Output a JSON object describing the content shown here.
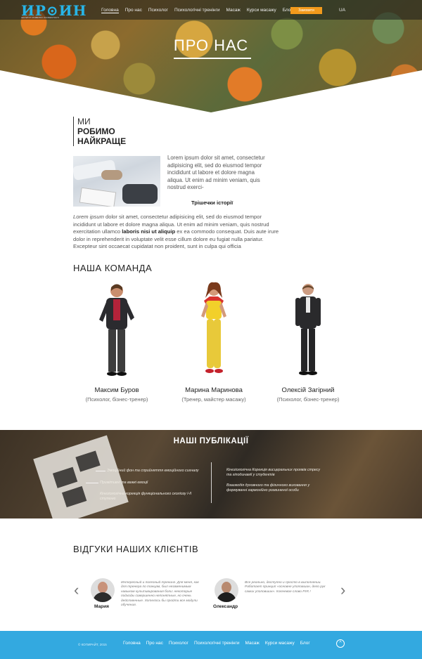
{
  "header": {
    "logo_text": "ИР⊙ИН",
    "logo_subtitle": "ІНСТИТУТ РОЗВИТКУ ОСОБИСТОСТІ",
    "nav": [
      "Головна",
      "Про нас",
      "Психолог",
      "Психологічні тренінги",
      "Масаж",
      "Курси масажу",
      "Блог"
    ],
    "order_button": "Замовити",
    "lang": "UA"
  },
  "hero": {
    "title": "ПРО НАС"
  },
  "about": {
    "we_line1": "МИ",
    "we_line2": "РОБИМО",
    "we_line3": "НАЙКРАЩЕ",
    "intro": "Lorem ipsum dolor sit amet, consectetur adipisicing elit, sed do eiusmod tempor incididunt ut labore et dolore magna aliqua. Ut enim ad minim veniam, quis nostrud exerci-",
    "more_link": "Трішечки історії",
    "body_em": "Lorem ipsum",
    "body_1": " dolor sit amet, consectetur adipisicing elit, sed do eiusmod tempor incididunt ut labore et dolore magna aliqua. Ut enim ad minim veniam, quis nostrud exercitation ullamco ",
    "body_bold": "laboris nisi ut aliquip",
    "body_2": " ex ea commodo consequat. Duis aute irure dolor in reprehenderit in voluptate velit esse cillum dolore eu fugiat nulla pariatur. Excepteur sint occaecat cupidatat non proident, sunt in culpa qui officia"
  },
  "team": {
    "title": "НАША КОМАНДА",
    "members": [
      {
        "name": "Максим Буров",
        "role": "(Психолог, бізнес-тренер)"
      },
      {
        "name": "Марина Маринова",
        "role": "(Тренер, майстер масажу)"
      },
      {
        "name": "Олексій Загірний",
        "role": "(Психолог, бізнес-тренер)"
      }
    ]
  },
  "publications": {
    "title": "НАШІ ПУБЛІКАЦІЇ",
    "left": [
      "Эмоційний фон та сприйняття емоційного сигналу",
      "Примітивні та важкі емоції",
      "Кінезіологічна корекція функціонального сколіозу I-II ступеню"
    ],
    "right": [
      "Кінезіологічна Корекція висцеральних проявів стресу та гіподинамії у студентів",
      "Взаємодія духовного та фізичного виховання у формуванні гармонійно розвиненої особи"
    ]
  },
  "reviews": {
    "title": "ВІДГУКИ НАШИХ КЛІЄНТІВ",
    "prev_arrow": "‹",
    "next_arrow": "›",
    "items": [
      {
        "name": "Мария",
        "text": "Интересный и полезный тренинг. Для меня, как для тренера по танцам, был незаменимым навыком культивирования боли: некоторые подходы совершенно непонятные, но очень действенные. Хотелось бы пройти все модули обучения."
      },
      {
        "name": "Олександр",
        "text": "Все реально, доступно и просто в выполнении. Работает принцип «основне упоповшин, дело рук самих упоповшин». Ключевое слово РУК !"
      }
    ]
  },
  "footer": {
    "copyright": "© КОПИРАЙТ, 2015",
    "nav": [
      "Головна",
      "Про нас",
      "Психолог",
      "Психологічні тренінги",
      "Масаж",
      "Курси масажу",
      "Блог"
    ],
    "totop": "^"
  }
}
